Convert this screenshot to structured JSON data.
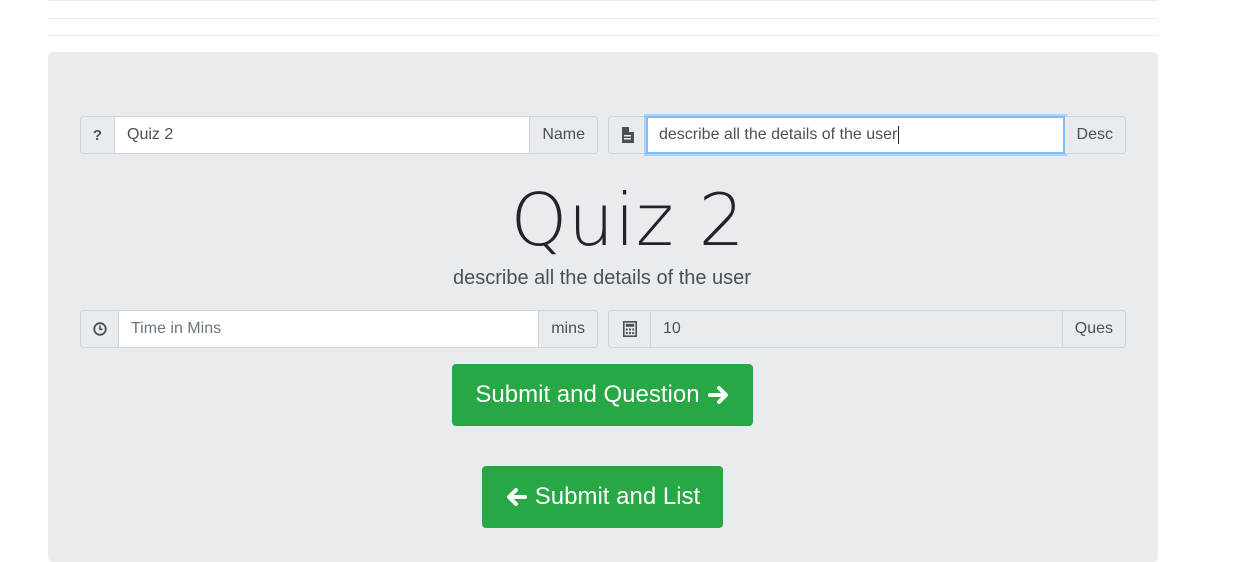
{
  "name_group": {
    "icon": "question-icon",
    "icon_glyph": "?",
    "value": "Quiz 2",
    "suffix": "Name"
  },
  "desc_group": {
    "icon": "file-text-icon",
    "value": "describe all the details of the user",
    "suffix": "Desc"
  },
  "heading": {
    "title": "Quiz 2",
    "lead": "describe all the details of the user"
  },
  "time_group": {
    "icon": "clock-icon",
    "placeholder": "Time in Mins",
    "suffix": "mins"
  },
  "ques_group": {
    "icon": "calculator-icon",
    "value": "10",
    "suffix": "Ques"
  },
  "buttons": {
    "submit_question": "Submit and Question",
    "submit_list": "Submit and List"
  },
  "colors": {
    "panel_bg": "#e9ecef",
    "success": "#28a745",
    "focus_border": "#80bdff"
  }
}
